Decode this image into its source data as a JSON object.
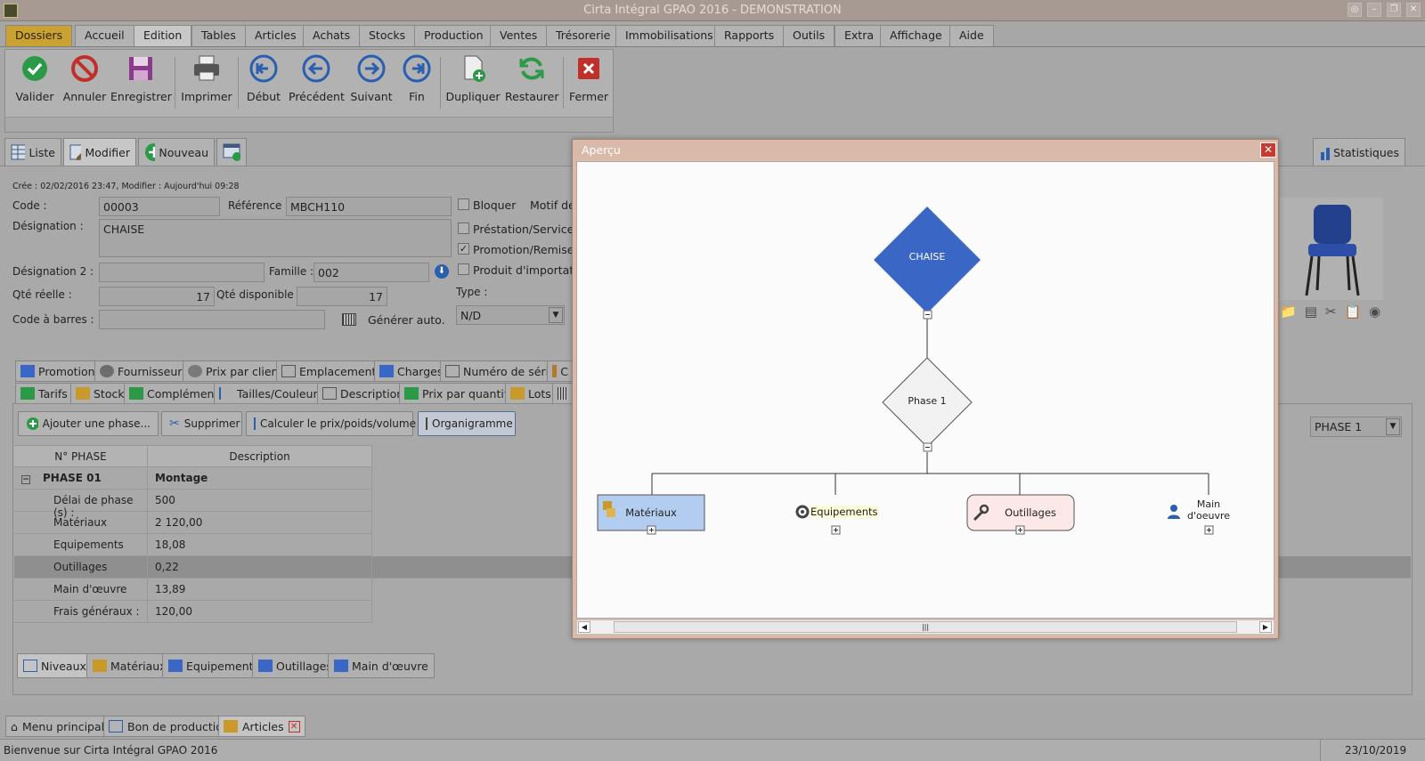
{
  "window": {
    "title": "Cirta Intégral GPAO 2016 - DEMONSTRATION"
  },
  "menu": [
    "Dossiers",
    "Accueil",
    "Edition",
    "Tables",
    "Articles",
    "Achats",
    "Stocks",
    "Production",
    "Ventes",
    "Trésorerie",
    "Immobilisations",
    "Rapports",
    "Outils",
    "Extra",
    "Affichage",
    "Aide"
  ],
  "toolbar": {
    "valider": "Valider",
    "annuler": "Annuler",
    "enregistrer": "Enregistrer",
    "imprimer": "Imprimer",
    "debut": "Début",
    "precedent": "Précédent",
    "suivant": "Suivant",
    "fin": "Fin",
    "dupliquer": "Dupliquer",
    "restaurer": "Restaurer",
    "fermer": "Fermer"
  },
  "viewtabs": {
    "liste": "Liste",
    "modifier": "Modifier",
    "nouveau": "Nouveau",
    "statistiques": "Statistiques"
  },
  "form": {
    "meta": "Crée : 02/02/2016 23:47, Modifier : Aujourd'hui 09:28",
    "code_label": "Code :",
    "code": "00003",
    "reference_label": "Référence :",
    "reference": "MBCH110",
    "designation_label": "Désignation :",
    "designation": "CHAISE",
    "designation2_label": "Désignation 2 :",
    "designation2": "",
    "famille_label": "Famille :",
    "famille": "002",
    "qte_reelle_label": "Qté réelle :",
    "qte_reelle": "17",
    "qte_disponible_label": "Qté disponible :",
    "qte_disponible": "17",
    "code_barres_label": "Code à barres :",
    "code_barres": "",
    "generer_auto": "Générer auto.",
    "bloquer": "Bloquer",
    "motif": "Motif de",
    "prestation": "Préstation/Service",
    "promotion": "Promotion/Remise",
    "produit_import": "Produit d'importati",
    "type_label": "Type :",
    "type": "N/D"
  },
  "subtabs_row1": [
    "Promotion",
    "Fournisseurs",
    "Prix par client",
    "Emplacements",
    "Charges",
    "Numéro de série",
    "C"
  ],
  "subtabs_row2": [
    "Tarifs",
    "Stock",
    "Complément",
    "Tailles/Couleurs",
    "Description",
    "Prix par quantité",
    "Lots",
    ""
  ],
  "actions": {
    "ajouter": "Ajouter une phase...",
    "supprimer": "Supprimer",
    "calculer": "Calculer le prix/poids/volume",
    "organigramme": "Organigramme"
  },
  "phase_select": "PHASE 1",
  "grid": {
    "headers": [
      "N° PHASE",
      "Description"
    ],
    "phase": {
      "name": "PHASE 01",
      "desc": "Montage"
    },
    "rows": [
      {
        "label": "Délai de phase (s) :",
        "value": "500"
      },
      {
        "label": "Matériaux",
        "value": "2 120,00"
      },
      {
        "label": "Equipements",
        "value": "18,08"
      },
      {
        "label": "Outillages",
        "value": "0,22"
      },
      {
        "label": "Main d'œuvre",
        "value": "13,89"
      },
      {
        "label": "Frais généraux :",
        "value": "120,00"
      }
    ]
  },
  "bottomtabs": [
    "Niveaux",
    "Matériaux",
    "Equipements",
    "Outillages",
    "Main d'œuvre"
  ],
  "tasktabs": [
    "Menu principal",
    "Bon de production",
    "Articles"
  ],
  "status": {
    "message": "Bienvenue sur Cirta Intégral GPAO 2016",
    "date": "23/10/2019"
  },
  "modal": {
    "title": "Aperçu",
    "root": "CHAISE",
    "phase": "Phase 1",
    "leaves": [
      "Matériaux",
      "Equipements",
      "Outillages",
      "Main\nd'oeuvre"
    ],
    "colors": {
      "root": "#3a66c6",
      "leaf_materiaux": "#b3cdf0",
      "leaf_outillages": "#fde8e8"
    }
  }
}
